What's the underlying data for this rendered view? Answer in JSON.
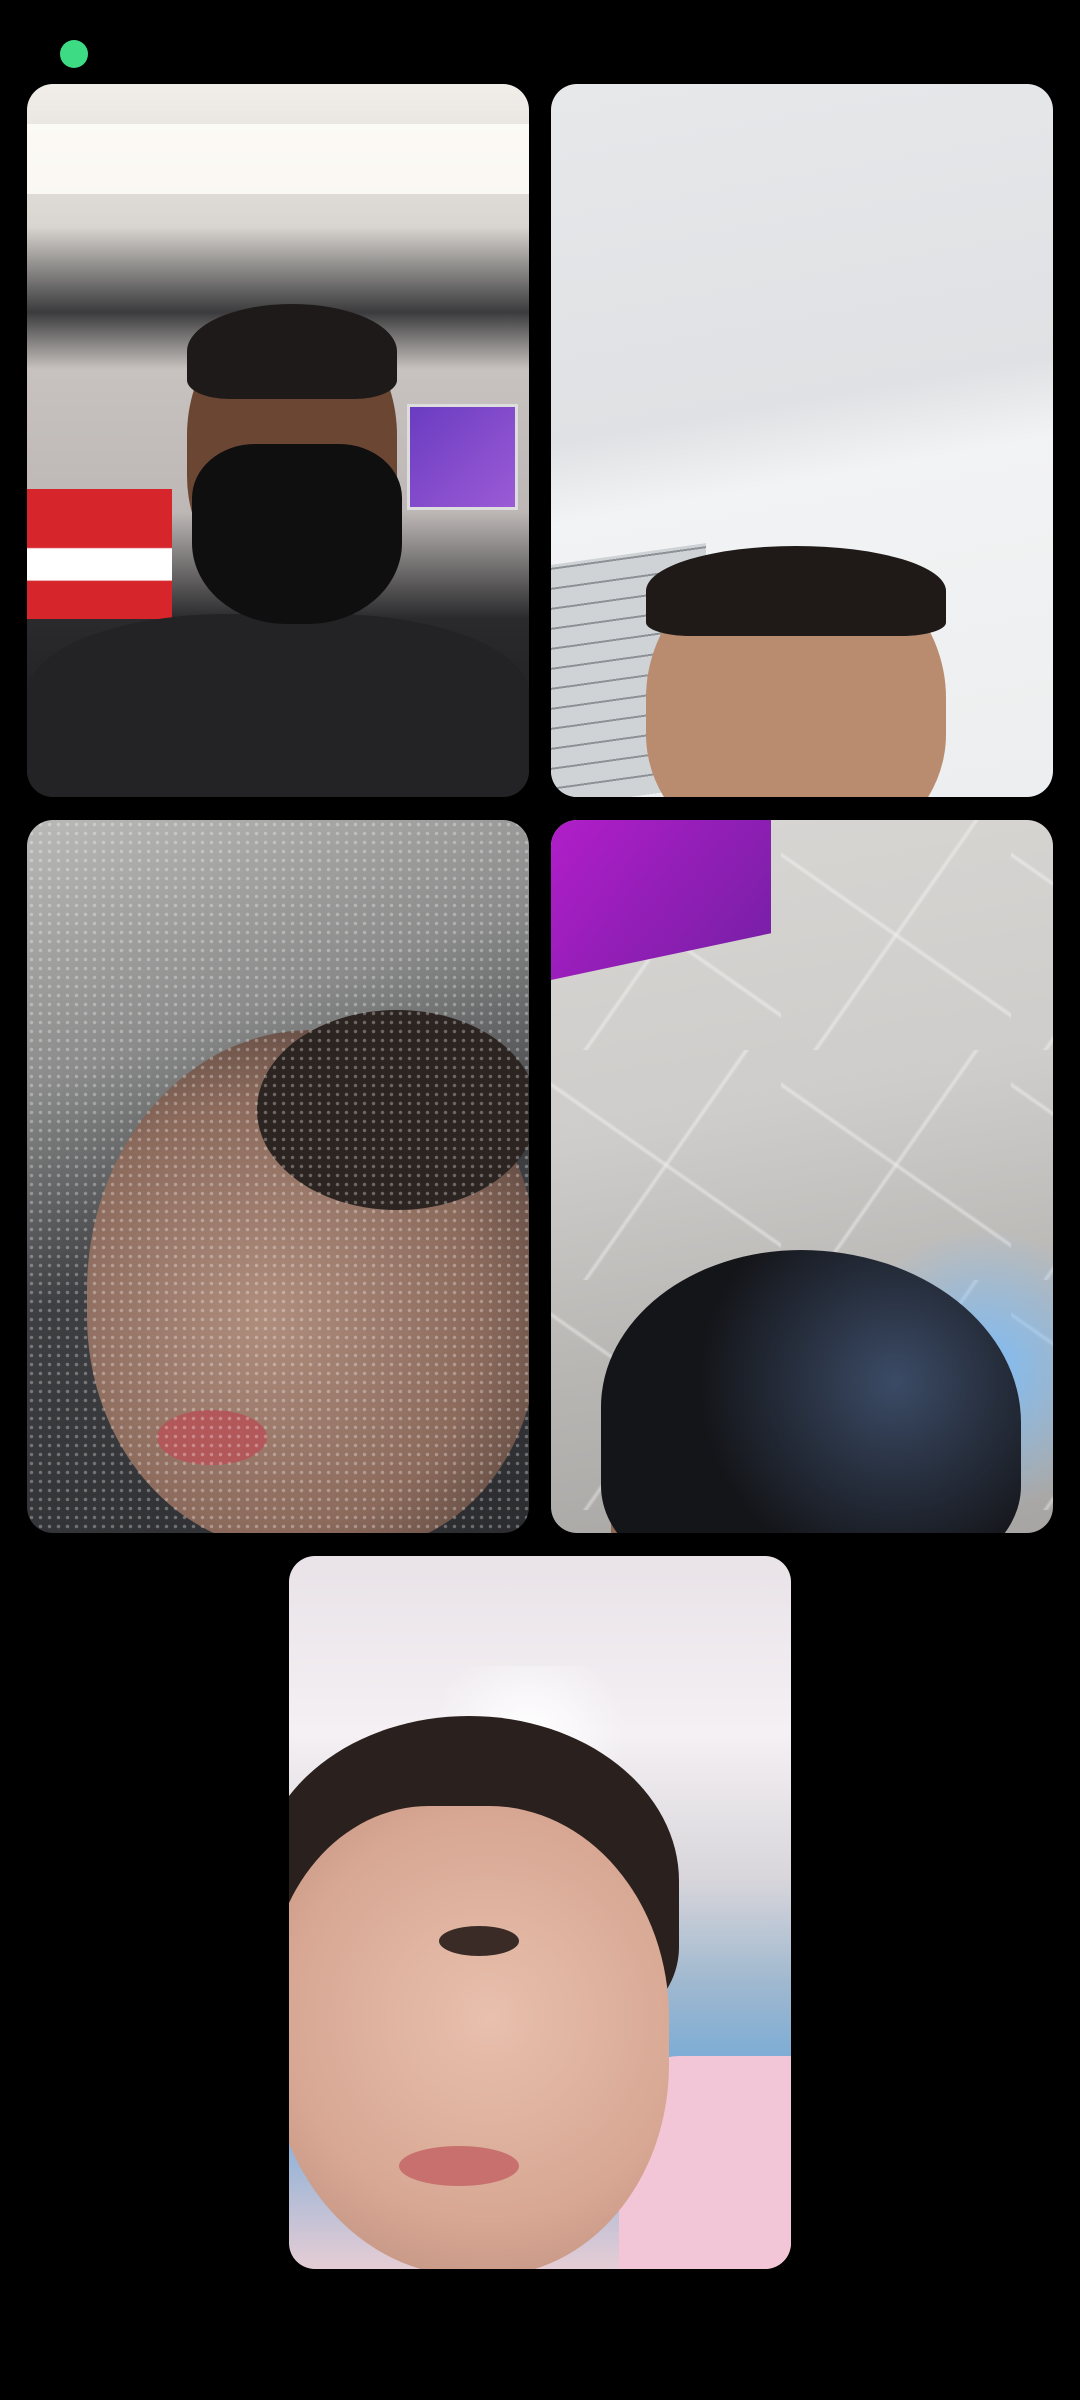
{
  "status": {
    "indicator_color": "#3ddc84"
  },
  "participants": [
    {
      "id": "p1",
      "description_icon": "video-feed"
    },
    {
      "id": "p2",
      "description_icon": "video-feed"
    },
    {
      "id": "p3",
      "description_icon": "video-feed"
    },
    {
      "id": "p4",
      "description_icon": "video-feed"
    },
    {
      "id": "p5",
      "description_icon": "video-feed"
    }
  ]
}
